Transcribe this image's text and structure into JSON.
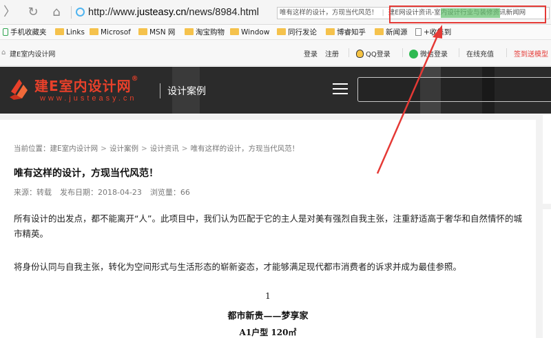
{
  "browser": {
    "forward_glyph": "〉",
    "reload_glyph": "↻",
    "home_glyph": "⌂",
    "url_prefix": "http://www.",
    "url_domain": "justeasy.cn",
    "url_path": "/news/8984.html",
    "tabs": [
      "唯有这样的设计，方现当代风范！",
      "建E网设计资讯-室内设计行业与装修资讯新闻网"
    ],
    "highlight_color": "#e53935"
  },
  "favorites": {
    "items": [
      {
        "label": "手机收藏夹",
        "icon": "phone-icon"
      },
      {
        "label": "Links",
        "icon": "folder-icon"
      },
      {
        "label": "Microsof",
        "icon": "folder-icon"
      },
      {
        "label": "MSN 网",
        "icon": "folder-icon"
      },
      {
        "label": "淘宝购物",
        "icon": "folder-icon"
      },
      {
        "label": "Window",
        "icon": "folder-icon"
      },
      {
        "label": "同行发论",
        "icon": "folder-icon"
      },
      {
        "label": "博睿知乎",
        "icon": "folder-icon"
      },
      {
        "label": "新闻源",
        "icon": "folder-icon"
      },
      {
        "label": "+收集到",
        "icon": "page-icon"
      }
    ]
  },
  "topbar": {
    "site_name": "建E室内设计网",
    "login": "登录",
    "register": "注册",
    "qq_login": "QQ登录",
    "wechat_login": "微信登录",
    "recharge": "在线充值",
    "signin": "签到送模型"
  },
  "header": {
    "logo_cn": "建E室内设计网",
    "logo_reg": "®",
    "logo_en": "www.justeasy.cn",
    "section": "设计案例",
    "brand_color": "#e8402a"
  },
  "article": {
    "breadcrumb": [
      "当前位置：建E室内设计网",
      "设计案例",
      "设计资讯",
      "唯有这样的设计，方现当代风范！"
    ],
    "title": "唯有这样的设计，方现当代风范！",
    "source": "来源：转载",
    "date": "发布日期：2018-04-23",
    "views": "浏览量：66",
    "paragraphs": [
      "所有设计的出发点，都不能离开“人”。此项目中，我们认为匹配于它的主人是对美有强烈自我主张，注重舒适高于奢华和自然情怀的城市精英。",
      "将身份认同与自我主张，转化为空间形式与生活形态的崭新姿态，才能够满足现代都市消费者的诉求并成为最佳参照。"
    ],
    "section_number": "1",
    "section_title": "都市新贵——梦享家",
    "section_sub": "A1户型 120㎡"
  }
}
